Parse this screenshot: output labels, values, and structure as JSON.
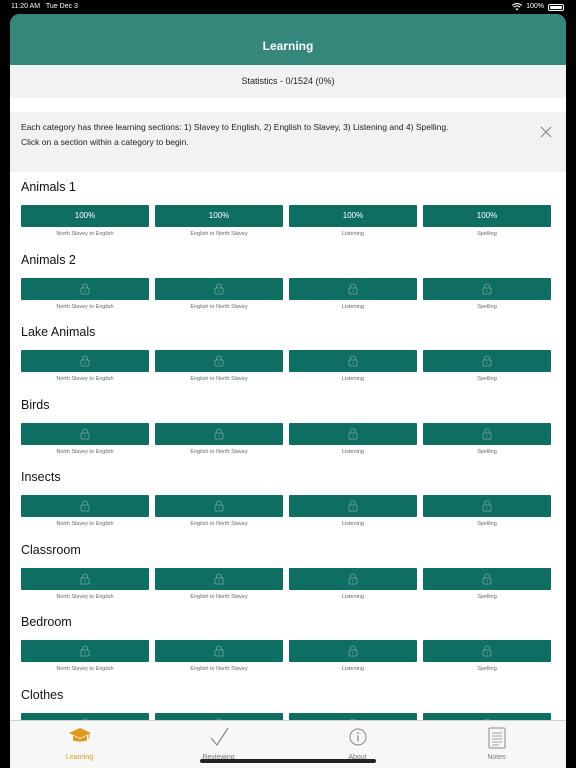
{
  "status": {
    "time": "11:20 AM",
    "date": "Tue Dec 3",
    "battery": "100%"
  },
  "header": {
    "title": "Learning"
  },
  "statistics": {
    "text": "Statistics - 0/1524 (0%)"
  },
  "info": {
    "line1": "Each category has three learning sections: 1) Slavey to English, 2) English to Slavey, 3) Listening and 4) Spelling.",
    "line2": "Click on a section within a category to begin."
  },
  "sections": [
    "North Slavey to English",
    "English to North Slavey",
    "Listening",
    "Spelling"
  ],
  "categories": [
    {
      "name": "Animals 1",
      "progress": [
        "100%",
        "100%",
        "100%",
        "100%"
      ],
      "locked": false
    },
    {
      "name": "Animals 2",
      "locked": true
    },
    {
      "name": "Lake Animals",
      "locked": true
    },
    {
      "name": "Birds",
      "locked": true
    },
    {
      "name": "Insects",
      "locked": true
    },
    {
      "name": "Classroom",
      "locked": true
    },
    {
      "name": "Bedroom",
      "locked": true
    },
    {
      "name": "Clothes",
      "locked": true
    }
  ],
  "tabs": [
    {
      "label": "Learning",
      "icon": "graduation-cap-icon",
      "active": true
    },
    {
      "label": "Reviewing",
      "icon": "checkmark-icon",
      "active": false
    },
    {
      "label": "About",
      "icon": "info-icon",
      "active": false
    },
    {
      "label": "Notes",
      "icon": "notes-icon",
      "active": false
    }
  ],
  "colors": {
    "header": "#35877b",
    "button": "#0f6e62",
    "active_tab": "#e09a1d"
  }
}
